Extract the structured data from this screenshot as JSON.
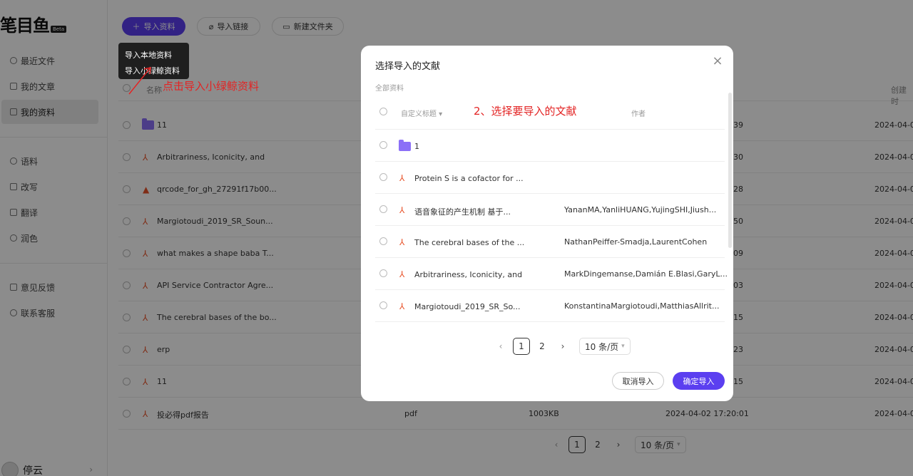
{
  "brand": {
    "logo": "笔目鱼",
    "badge": "Beta"
  },
  "sidebar": {
    "items": [
      {
        "label": "最近文件",
        "icon": "clock-icon"
      },
      {
        "label": "我的文章",
        "icon": "document-icon"
      },
      {
        "label": "我的资料",
        "icon": "folder-icon",
        "active": true
      },
      {
        "label": "语料",
        "icon": "search-icon"
      },
      {
        "label": "改写",
        "icon": "edit-icon"
      },
      {
        "label": "翻译",
        "icon": "translate-icon"
      },
      {
        "label": "润色",
        "icon": "sparkle-icon"
      },
      {
        "label": "意见反馈",
        "icon": "feedback-icon"
      },
      {
        "label": "联系客服",
        "icon": "headset-icon"
      }
    ],
    "user": {
      "name": "停云"
    }
  },
  "toolbar": {
    "import_label": "导入资料",
    "import_link_label": "导入链接",
    "new_folder_label": "新建文件夹"
  },
  "import_menu": {
    "items": [
      "导入本地资料",
      "导入小绿鲸资料"
    ]
  },
  "annotations": {
    "step1": "点击导入小绿鲸资料",
    "step2": "2、选择要导入的文献"
  },
  "table": {
    "columns": {
      "name": "名称",
      "created": "创建时"
    },
    "rows": [
      {
        "name": "11",
        "type": "folder",
        "date": "2024-04-0",
        "partial": "39"
      },
      {
        "name": "Arbitrariness, Iconicity, and",
        "type": "pdf",
        "date": "2024-04-0",
        "partial": "30"
      },
      {
        "name": "qrcode_for_gh_27291f17b00...",
        "type": "image",
        "date": "2024-04-0",
        "partial": "28"
      },
      {
        "name": "Margiotoudi_2019_SR_Soun...",
        "type": "pdf",
        "date": "2024-04-0",
        "partial": "50"
      },
      {
        "name": "what makes a shape baba T...",
        "type": "pdf",
        "date": "2024-04-0",
        "partial": "09"
      },
      {
        "name": "API Service Contractor Agre...",
        "type": "pdf",
        "date": "2024-04-0",
        "partial": "03"
      },
      {
        "name": "The cerebral bases of the bo...",
        "type": "pdf",
        "date": "2024-04-0",
        "partial": "15"
      },
      {
        "name": "erp",
        "type": "pdf",
        "date": "2024-04-0",
        "partial": "23"
      },
      {
        "name": "11",
        "type": "pdf",
        "date": "2024-04-0",
        "partial": "15"
      },
      {
        "name": "投必得pdf报告",
        "type": "pdf",
        "filetype": "pdf",
        "size": "1003KB",
        "modified": "2024-04-02 17:20:01",
        "date": "2024-04-0"
      }
    ],
    "pagination": {
      "pages": [
        "1",
        "2"
      ],
      "current": "1",
      "page_size": "10 条/页"
    }
  },
  "modal": {
    "title": "选择导入的文献",
    "breadcrumb": "全部资料",
    "columns": {
      "title": "自定义标题",
      "author": "作者"
    },
    "rows": [
      {
        "name": "1",
        "type": "folder",
        "author": ""
      },
      {
        "name": "Protein S is a cofactor for ...",
        "type": "pdf",
        "author": ""
      },
      {
        "name": "语音象征的产生机制 基于...",
        "type": "pdf",
        "author": "YananMA,YanliHUANG,YujingSHI,Jiush..."
      },
      {
        "name": "The cerebral bases of the ...",
        "type": "pdf",
        "author": "NathanPeiffer-Smadja,LaurentCohen"
      },
      {
        "name": "Arbitrariness, Iconicity, and",
        "type": "pdf",
        "author": "MarkDingemanse,Damián E.Blasi,GaryL..."
      },
      {
        "name": "Margiotoudi_2019_SR_So...",
        "type": "pdf",
        "author": "KonstantinaMargiotoudi,MatthiasAllrit..."
      }
    ],
    "pagination": {
      "pages": [
        "1",
        "2"
      ],
      "current": "1",
      "page_size": "10 条/页"
    },
    "cancel_label": "取消导入",
    "confirm_label": "确定导入"
  },
  "colors": {
    "accent": "#5b3ff0",
    "annotation": "#e32424",
    "pdf_icon": "#e8532a",
    "folder": "#8b6ff7"
  }
}
